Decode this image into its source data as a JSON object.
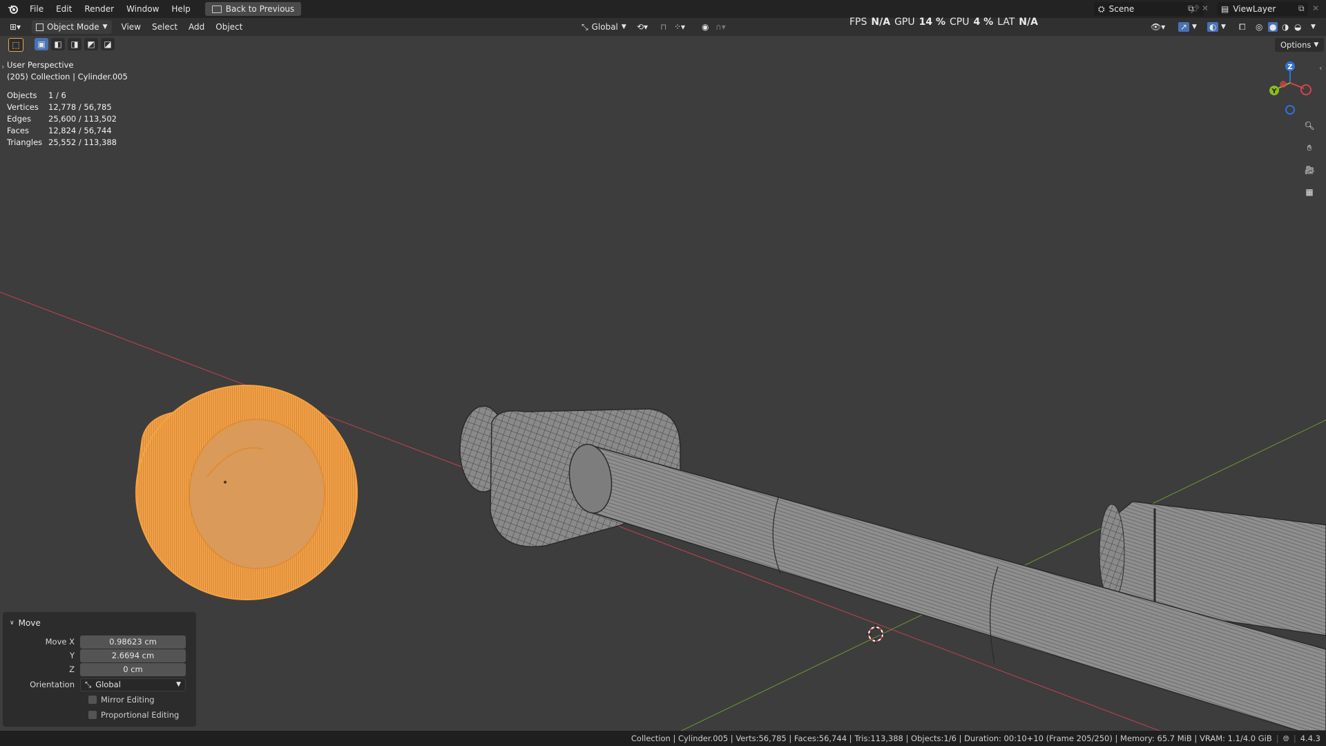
{
  "menubar": {
    "items": [
      "File",
      "Edit",
      "Render",
      "Window",
      "Help"
    ],
    "back_label": "Back to Previous",
    "scene_label": "Scene",
    "viewlayer_label": "ViewLayer"
  },
  "header": {
    "mode_label": "Object Mode",
    "menus": [
      "View",
      "Select",
      "Add",
      "Object"
    ],
    "orientation_label": "Global",
    "options_label": "Options"
  },
  "perf": {
    "fps_label": "FPS",
    "fps_value": "N/A",
    "gpu_label": "GPU",
    "gpu_value": "14 %",
    "cpu_label": "CPU",
    "cpu_value": "4 %",
    "lat_label": "LAT",
    "lat_value": "N/A"
  },
  "viewport": {
    "view_name": "User Perspective",
    "context": "(205) Collection | Cylinder.005",
    "stats": [
      {
        "key": "Objects",
        "value": "1 / 6"
      },
      {
        "key": "Vertices",
        "value": "12,778 / 56,785"
      },
      {
        "key": "Edges",
        "value": "25,600 / 113,502"
      },
      {
        "key": "Faces",
        "value": "12,824 / 56,744"
      },
      {
        "key": "Triangles",
        "value": "25,552 / 113,388"
      }
    ],
    "gizmo": {
      "z": "Z",
      "y": "Y"
    }
  },
  "operator_panel": {
    "title": "Move",
    "move_x_label": "Move X",
    "move_x": "0.98623 cm",
    "y_label": "Y",
    "move_y": "2.6694 cm",
    "z_label": "Z",
    "move_z": "0 cm",
    "orientation_label": "Orientation",
    "orientation_value": "Global",
    "mirror_label": "Mirror Editing",
    "proportional_label": "Proportional Editing"
  },
  "statusbar": {
    "text": "Collection | Cylinder.005 | Verts:56,785 | Faces:56,744 | Tris:113,388 | Objects:1/6 | Duration: 00:10+10 (Frame 205/250) | Memory: 65.7 MiB | VRAM: 1.1/4.0 GiB",
    "version": "4.4.3"
  },
  "colors": {
    "background": "#3d3d3d",
    "selection_orange": "#f5a340",
    "x_axis": "#c4424d",
    "y_axis": "#6d9a2f",
    "gizmo_z": "#2f73d8",
    "gizmo_x": "#d8434c",
    "gizmo_y": "#8cbc1f"
  }
}
